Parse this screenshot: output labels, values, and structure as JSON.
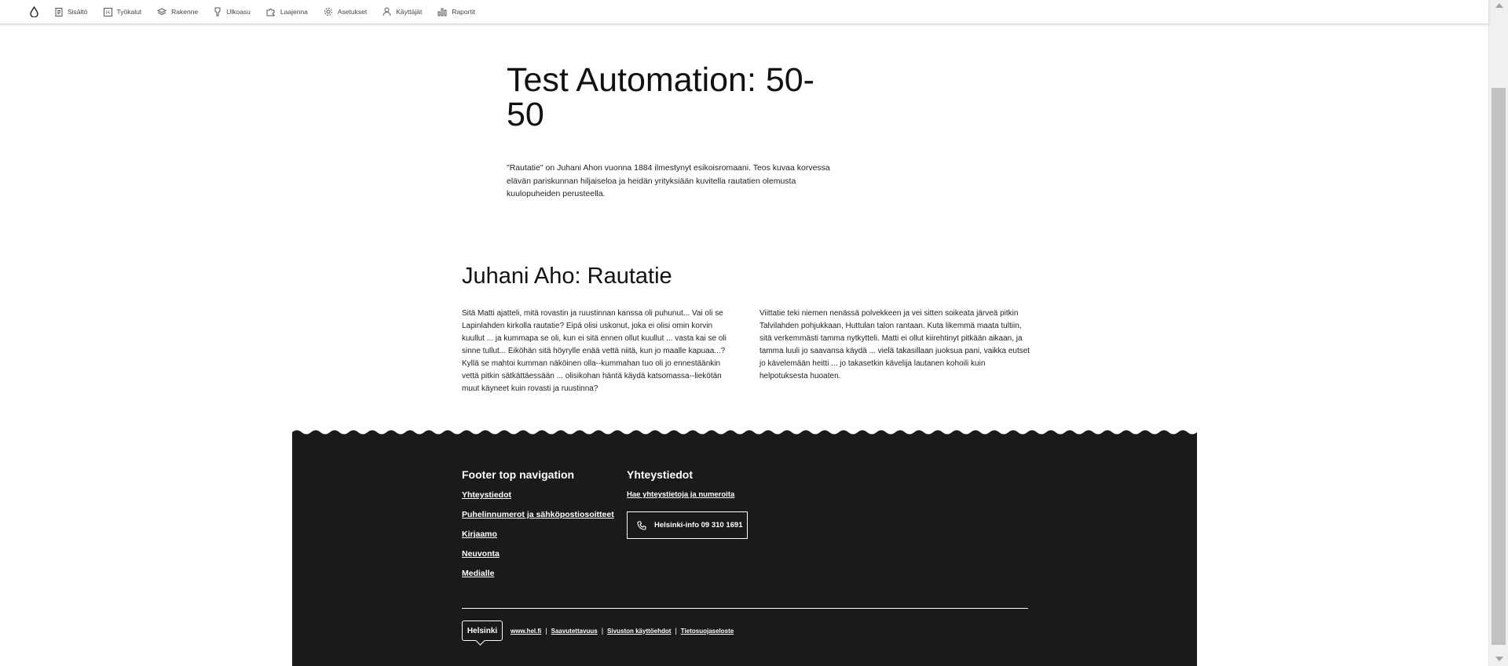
{
  "toolbar": {
    "items": [
      {
        "label": "Sisältö",
        "icon": "document-icon"
      },
      {
        "label": "Työkalut",
        "icon": "tools-icon"
      },
      {
        "label": "Rakenne",
        "icon": "layers-icon"
      },
      {
        "label": "Ulkoasu",
        "icon": "brush-icon"
      },
      {
        "label": "Laajenna",
        "icon": "puzzle-icon"
      },
      {
        "label": "Asetukset",
        "icon": "gear-icon"
      },
      {
        "label": "Käyttäjät",
        "icon": "user-icon"
      },
      {
        "label": "Raportit",
        "icon": "bar-chart-icon"
      }
    ]
  },
  "hero": {
    "title": "Test Automation: 50-50",
    "lead": "\"Rautatie\" on Juhani Ahon vuonna 1884 ilmestynyt esikoisromaani. Teos kuvaa korvessa elävän pariskunnan hiljaiseloa ja heidän yrityksiään kuvitella rautatien olemusta kuulopuheiden perusteella."
  },
  "section": {
    "title": "Juhani Aho: Rautatie",
    "col1": "Sitä Matti ajatteli, mitä rovastin ja ruustinnan kanssa oli puhunut... Vai oli se Lapinlahden kirkolla rautatie? Eipä olisi uskonut, joka ei olisi omin korvin kuullut ... ja kummapa se oli, kun ei sitä ennen ollut kuullut ... vasta kai se oli sinne tullut... Eiköhän sitä höyrylle enää vettä niitä, kun jo maalle kapuaa...? Kyllä se mahtoi kumman näköinen olla--kummahan tuo oli jo ennestäänkin vettä pitkin sätkättäessään ... olisikohan häntä käydä katsomassa--liekötän muut käyneet kuin rovasti ja ruustinna?",
    "col2": " Viittatie teki niemen nenässä polvekkeen ja vei sitten soikeata järveä pitkin Talvilahden pohjukkaan, Huttulan talon rantaan. Kuta likemmä maata tultiin, sitä verkemmästi tamma nytkytteli. Matti ei ollut kiirehtinyt pitkään aikaan, ja tamma luuli jo saavansa käydä ... vielä takasillaan juoksua pani, vaikka eutset jo kävelemään heitti ... jo takasetkin kävelija lautanen kohoili kuin helpotuksesta huoaten."
  },
  "footer": {
    "nav_heading": "Footer top navigation",
    "nav_links": [
      "Yhteystiedot",
      "Puhelinnumerot ja sähköpostiosoitteet",
      "Kirjaamo",
      "Neuvonta",
      "Medialle"
    ],
    "contact_heading": "Yhteystiedot",
    "contact_link": "Hae yhteystietoja ja numeroita",
    "phone_button": "Helsinki-info 09 310 1691",
    "logo": "Helsinki",
    "bottom_links": [
      "www.hel.fi",
      "Saavutettavuus",
      "Sivuston käyttöehdot",
      "Tietosuojaseloste"
    ]
  }
}
